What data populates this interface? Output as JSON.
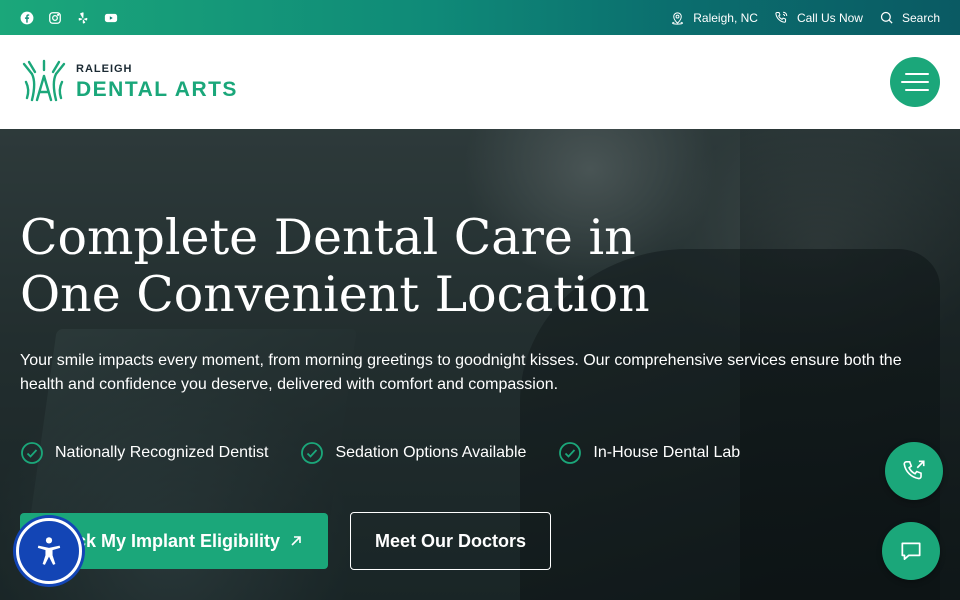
{
  "topbar": {
    "social": [
      "facebook-icon",
      "instagram-icon",
      "yelp-icon",
      "youtube-icon"
    ],
    "location": "Raleigh, NC",
    "call": "Call Us Now",
    "search": "Search"
  },
  "header": {
    "logo_line1": "RALEIGH",
    "logo_line2": "DENTAL ARTS"
  },
  "hero": {
    "title": "Complete Dental Care in One Convenient Location",
    "subtitle": "Your smile impacts every moment, from morning greetings to goodnight kisses. Our comprehensive services ensure both the health and confidence you deserve, delivered with comfort and compassion.",
    "features": [
      "Nationally Recognized Dentist",
      "Sedation Options Available",
      "In-House Dental Lab"
    ],
    "primary_button": "Check My Implant Eligibility",
    "secondary_button": "Meet Our Doctors"
  },
  "colors": {
    "brand_green": "#1ba77a",
    "accessibility_blue": "#1345b5"
  }
}
